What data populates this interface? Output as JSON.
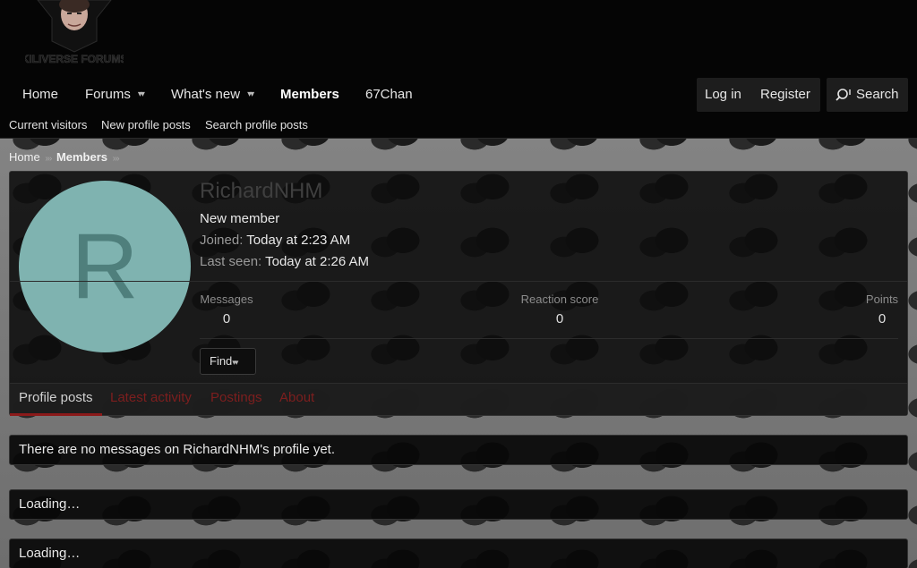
{
  "header": {
    "logo_text": "KILIVERSE FORUMS",
    "nav": [
      {
        "label": "Home"
      },
      {
        "label": "Forums"
      },
      {
        "label": "What's new"
      },
      {
        "label": "Members"
      },
      {
        "label": "67Chan"
      }
    ],
    "login_label": "Log in",
    "register_label": "Register",
    "search_label": "Search",
    "subnav": [
      {
        "label": "Current visitors"
      },
      {
        "label": "New profile posts"
      },
      {
        "label": "Search profile posts"
      }
    ]
  },
  "breadcrumb": [
    {
      "label": "Home"
    },
    {
      "label": "Members"
    }
  ],
  "profile": {
    "avatar_letter": "R",
    "username": "RichardNHM",
    "user_title": "New member",
    "joined_label": "Joined:",
    "joined_value": "Today at 2:23 AM",
    "last_seen_label": "Last seen:",
    "last_seen_value": "Today at 2:26 AM",
    "stats": [
      {
        "label": "Messages",
        "value": "0"
      },
      {
        "label": "Reaction score",
        "value": "0"
      },
      {
        "label": "Points",
        "value": "0"
      }
    ],
    "find_label": "Find",
    "tabs": [
      {
        "label": "Profile posts"
      },
      {
        "label": "Latest activity"
      },
      {
        "label": "Postings"
      },
      {
        "label": "About"
      }
    ]
  },
  "messages": {
    "empty_text": "There are no messages on RichardNHM's profile yet.",
    "loading_1": "Loading…",
    "loading_2": "Loading…"
  },
  "colors": {
    "header_bg": "#050505",
    "avatar_bg": "#7fb3b0",
    "active_tab_underline": "#8b1a1a"
  }
}
